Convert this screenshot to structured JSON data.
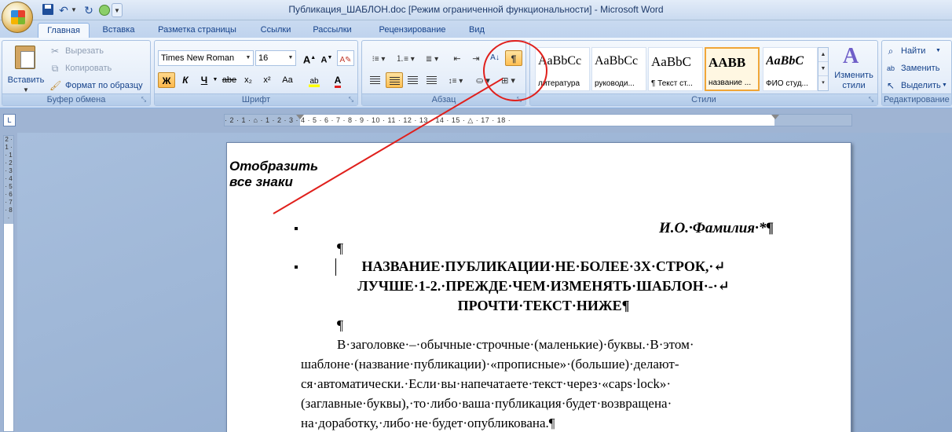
{
  "window": {
    "title": "Публикация_ШАБЛОН.doc [Режим ограниченной функциональности] - Microsoft Word"
  },
  "tabs": [
    {
      "label": "Главная",
      "active": true
    },
    {
      "label": "Вставка"
    },
    {
      "label": "Разметка страницы"
    },
    {
      "label": "Ссылки"
    },
    {
      "label": "Рассылки"
    },
    {
      "label": "Рецензирование"
    },
    {
      "label": "Вид"
    }
  ],
  "clipboard": {
    "group_label": "Буфер обмена",
    "paste_label": "Вставить",
    "cut_label": "Вырезать",
    "copy_label": "Копировать",
    "format_painter_label": "Формат по образцу"
  },
  "font": {
    "group_label": "Шрифт",
    "font_name": "Times New Roman",
    "font_size": "16",
    "bold": "Ж",
    "italic": "К",
    "underline": "Ч",
    "strikethrough": "abe",
    "subscript": "x₂",
    "superscript": "x²",
    "change_case": "Aa",
    "grow": "A",
    "shrink": "A"
  },
  "paragraph": {
    "group_label": "Абзац",
    "pilcrow": "¶",
    "sort": "А↓"
  },
  "styles": {
    "group_label": "Стили",
    "items": [
      {
        "sample": "AaBbCc",
        "caption": "литература"
      },
      {
        "sample": "AaBbCc",
        "caption": "руководи..."
      },
      {
        "sample": "AaBbC",
        "caption": "¶ Текст ст..."
      },
      {
        "sample": "AABB",
        "caption": "название ...",
        "selected": true
      },
      {
        "sample": "AaBbC",
        "caption": "ФИО студ..."
      }
    ],
    "change_styles_label_1": "Изменить",
    "change_styles_label_2": "стили"
  },
  "editing": {
    "group_label": "Редактирование",
    "find_label": "Найти",
    "replace_label": "Заменить",
    "select_label": "Выделить"
  },
  "ruler": {
    "ticks": "· 2 · 1 · ⌂ · 1 · 2 · 3 · 4 · 5 · 6 · 7 · 8 · 9 · 10 · 11 · 12 · 13 · 14 · 15 · △ · 17 · 18 ·"
  },
  "vertical_ruler": {
    "ticks": "2 · 1 · · 1 · 2 · 3 · 4 · 5 · 6 · 7 · 8 ·"
  },
  "annotation": {
    "label_line1": "Отобразить",
    "label_line2": "все знаки",
    "color": "#e0201c"
  },
  "document": {
    "author_line": "И.О.·Фамилия·*¶",
    "empty_para_1": "¶",
    "title_line_1": "НАЗВАНИЕ·ПУБЛИКАЦИИ·НЕ·БОЛЕЕ·3Х·СТРОК,·↵",
    "title_line_2": "ЛУЧШЕ·1-2.·ПРЕЖДЕ·ЧЕМ·ИЗМЕНЯТЬ·ШАБЛОН·-·↵",
    "title_line_3": "ПРОЧТИ·ТЕКСТ·НИЖЕ¶",
    "empty_para_2": "¶",
    "body_lines": [
      "В·заголовке·–·обычные·строчные·(маленькие)·буквы.·В·этом·",
      "шаблоне·(название·публикации)·«прописные»·(большие)·делают-",
      "ся·автоматически.·Если·вы·напечатаете·текст·через·«caps·lock»·",
      "(заглавные·буквы),·то·либо·ваша·публикация·будет·возвращена·",
      "на·доработку,·либо·не·будет·опубликована.¶"
    ]
  }
}
